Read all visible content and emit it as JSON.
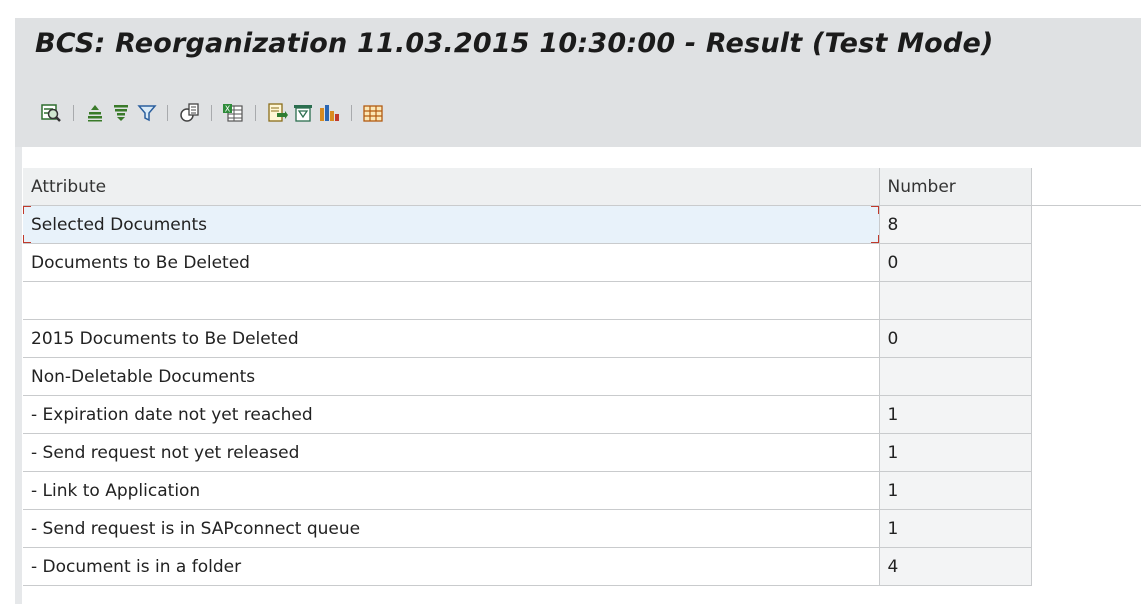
{
  "title": "BCS: Reorganization 11.03.2015 10:30:00 - Result (Test Mode)",
  "toolbar": {
    "items": [
      {
        "icon": "details-icon"
      },
      {
        "icon": "sort-ascending-icon"
      },
      {
        "icon": "sort-descending-icon"
      },
      {
        "icon": "filter-icon"
      },
      {
        "icon": "total-icon"
      },
      {
        "icon": "spreadsheet-export-icon"
      },
      {
        "icon": "local-file-export-icon"
      },
      {
        "icon": "print-preview-icon"
      },
      {
        "icon": "graphic-chart-icon"
      },
      {
        "icon": "change-layout-icon"
      }
    ]
  },
  "table": {
    "headers": {
      "attribute": "Attribute",
      "number": "Number"
    },
    "rows": [
      {
        "attribute": "Selected Documents",
        "number": "8"
      },
      {
        "attribute": "Documents to Be Deleted",
        "number": "0"
      },
      {
        "attribute": "",
        "number": ""
      },
      {
        "attribute": "2015 Documents to Be Deleted",
        "number": "0"
      },
      {
        "attribute": "Non-Deletable Documents",
        "number": ""
      },
      {
        "attribute": "- Expiration date not yet reached",
        "number": "1"
      },
      {
        "attribute": "- Send request not yet released",
        "number": "1"
      },
      {
        "attribute": "- Link to Application",
        "number": "1"
      },
      {
        "attribute": "- Send request is in SAPconnect queue",
        "number": "1"
      },
      {
        "attribute": "- Document is in a folder",
        "number": "4"
      }
    ]
  },
  "colors": {
    "title_bg": "#dfe1e3",
    "header_bg": "#eef0f1",
    "selected_row_bg": "#e8f2fa",
    "selection_marker": "#c0392b"
  }
}
